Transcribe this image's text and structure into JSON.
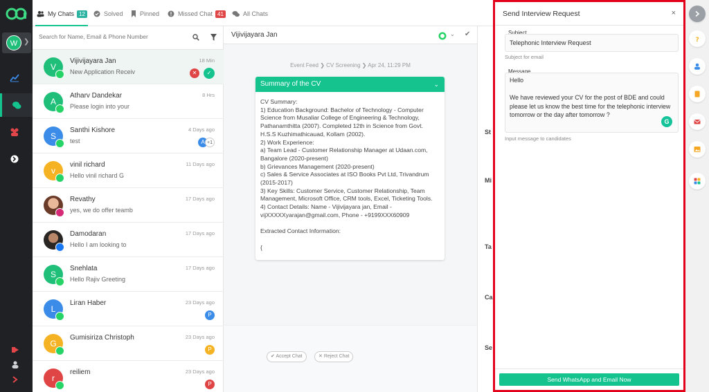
{
  "workspace": {
    "avatar": "W"
  },
  "tabs": [
    {
      "label": "My Chats",
      "badge": "12"
    },
    {
      "label": "Solved"
    },
    {
      "label": "Pinned"
    },
    {
      "label": "Missed Chat",
      "badge": "41"
    },
    {
      "label": "All Chats"
    }
  ],
  "search": {
    "placeholder": "Search for Name, Email & Phone Number"
  },
  "chats": [
    {
      "initial": "V",
      "name": "Vijivijayara Jan",
      "preview": "New Application Receiv",
      "time": "18 Min"
    },
    {
      "initial": "A",
      "name": "Atharv Dandekar",
      "preview": "Please login into your",
      "time": "8 Hrs"
    },
    {
      "initial": "S",
      "name": "Santhi Kishore",
      "preview": "test",
      "time": "4 Days ago",
      "extra": "+1"
    },
    {
      "initial": "v",
      "name": "vinil richard",
      "preview": "Hello vinil richard G",
      "time": "11 Days ago"
    },
    {
      "initial": "",
      "name": "Revathy",
      "preview": "yes, we do offer teamb",
      "time": "17 Days ago"
    },
    {
      "initial": "",
      "name": "Damodaran",
      "preview": "Hello I am looking to",
      "time": "17 Days ago"
    },
    {
      "initial": "S",
      "name": "Snehlata",
      "preview": "Hello Rajiv Greeting",
      "time": "17 Days ago"
    },
    {
      "initial": "L",
      "name": "Liran Haber",
      "preview": "",
      "time": "23 Days ago",
      "tag": "P"
    },
    {
      "initial": "G",
      "name": "Gumisiriza Christoph",
      "preview": "",
      "time": "23 Days ago",
      "tag": "P"
    },
    {
      "initial": "r",
      "name": "reiliem",
      "preview": "",
      "time": "23 Days ago",
      "tag": "P"
    }
  ],
  "conversation": {
    "title": "Vijivijayara Jan",
    "breadcrumb": "Event Feed ❯ CV Screening ❯ Apr 24, 11:29 PM",
    "card_title": "Summary of the CV",
    "card_lines": [
      "CV Summary:",
      "1) Education Background: Bachelor of Technology - Computer Science from Musaliar College of Engineering & Technology, Pathanamthitta (2007). Completed 12th in Science from Govt. H.S.S Kuzhimathicauad, Kollam (2002).",
      "2) Work Experience:",
      "a) Team Lead - Customer Relationship Manager at Udaan.com, Bangalore (2020-present)",
      "b) Grievances Management (2020-present)",
      "c) Sales & Service Associates at ISO Books Pvt Ltd, Trivandrum (2015-2017)",
      "3) Key Skills: Customer Service, Customer Relationship, Team Management, Microsoft Office, CRM tools, Excel, Ticketing Tools.",
      "4) Contact Details: Name - Vijivijayara jan, Email - vijXXXXXyarajan@gmail.com, Phone - +9199XXX60909",
      "",
      "Extracted Contact Information:",
      "",
      "{"
    ],
    "accept_label": "Accept Chat",
    "reject_label": "Reject Chat"
  },
  "details": {
    "labels": [
      "St",
      "Mi",
      "Ta",
      "Ca",
      "Se"
    ]
  },
  "modal": {
    "title": "Send Interview Request",
    "close": "×",
    "subject_label": "Subject",
    "subject_value": "Telephonic Interview Request",
    "subject_hint": "Subject for email",
    "message_label": "Message",
    "message_value": "Hello\n\nWe have reviewed your CV for the post of BDE and could please let us know the best time for the telephonic interview tomorrow or the day after tomorrow ?",
    "message_hint": "Input message to candidates",
    "send_label": "Send WhatsApp and Email Now"
  },
  "colors": {
    "accent": "#14c38e",
    "highlight_border": "#e3001b",
    "rail": "#1f2124"
  }
}
